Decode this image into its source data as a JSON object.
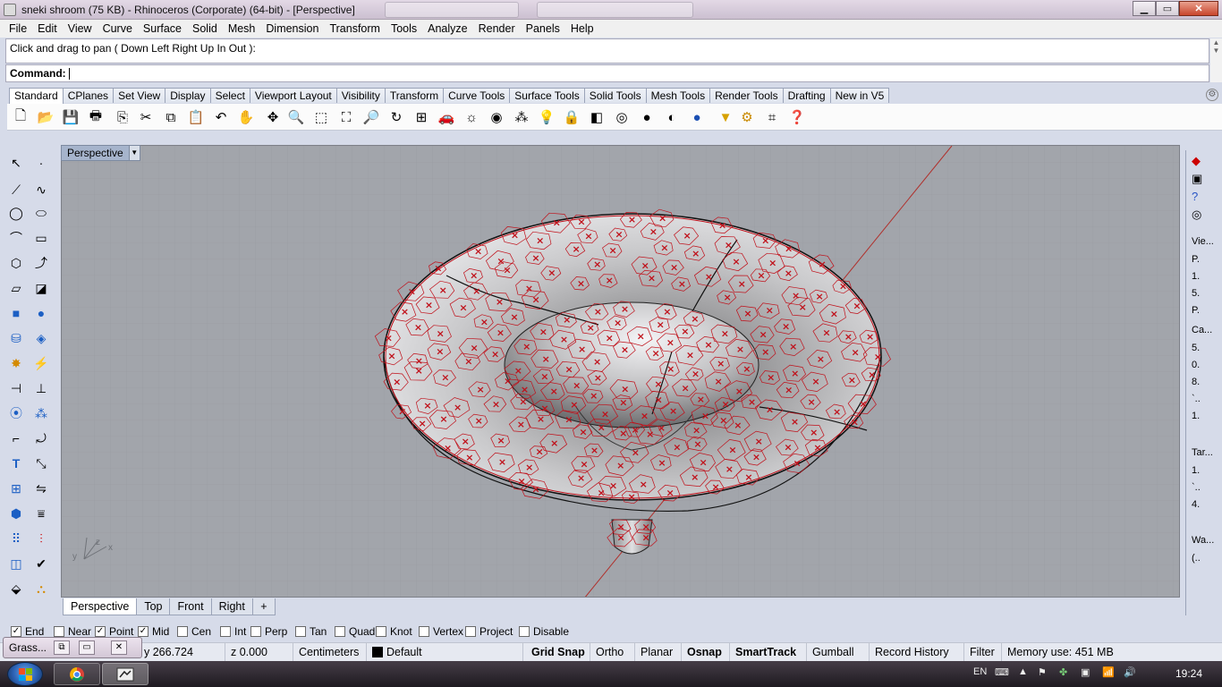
{
  "window": {
    "title": "sneki shroom (75 KB) - Rhinoceros (Corporate) (64-bit) - [Perspective]",
    "minimize_glyph": "▁",
    "maximize_glyph": "▭",
    "close_glyph": "✕"
  },
  "menu": [
    "File",
    "Edit",
    "View",
    "Curve",
    "Surface",
    "Solid",
    "Mesh",
    "Dimension",
    "Transform",
    "Tools",
    "Analyze",
    "Render",
    "Panels",
    "Help"
  ],
  "command": {
    "history": "Click and drag to pan ( Down  Left  Right  Up  In  Out ):",
    "prompt": "Command:",
    "value": ""
  },
  "toolbar_tabs": [
    "Standard",
    "CPlanes",
    "Set View",
    "Display",
    "Select",
    "Viewport Layout",
    "Visibility",
    "Transform",
    "Curve Tools",
    "Surface Tools",
    "Solid Tools",
    "Mesh Tools",
    "Render Tools",
    "Drafting",
    "New in V5"
  ],
  "toolbar_icons": [
    "new-icon",
    "open-icon",
    "save-icon",
    "print-icon",
    "import-icon",
    "cut-icon",
    "copy-icon",
    "paste-icon",
    "undo-icon",
    "pan-icon",
    "rotate-view-icon",
    "zoom-icon",
    "zoom-window-icon",
    "zoom-extents-icon",
    "zoom-selected-icon",
    "rotate-camera-icon",
    "four-viewports-icon",
    "car-icon",
    "light-icon",
    "point-display-icon",
    "grip-icon",
    "lightbulb-icon",
    "lock-icon",
    "layer-icon",
    "color-wheel-icon",
    "shaded-icon",
    "rendered-icon",
    "sphere-render-icon",
    "spotlight-icon",
    "settings-icon",
    "options-icon",
    "help-icon"
  ],
  "left_tool_icons": [
    "select-icon",
    "point-icon",
    "polyline-icon",
    "curve-icon",
    "circle-icon",
    "ellipse-icon",
    "arc-icon",
    "rectangle-icon",
    "polygon-icon",
    "freeform-curve-icon",
    "surface-icon",
    "sweep-icon",
    "box-icon",
    "sphere-icon",
    "cylinder-icon",
    "patch-icon",
    "explode-icon",
    "split-icon",
    "trim-icon",
    "extend-icon",
    "boolean-union-icon",
    "boolean-split-icon",
    "fillet-icon",
    "offset-icon",
    "text-icon",
    "scale-icon",
    "array-icon",
    "mirror-icon",
    "move-icon",
    "project-icon",
    "grid-icon",
    "align-icon",
    "dimension-icon",
    "check-icon",
    "render-icon",
    "paint-icon"
  ],
  "viewport": {
    "label": "Perspective",
    "axis_z": "z",
    "axis_y": "y",
    "axis_x": "x",
    "wireframe_color": "#c0101a",
    "background": "#a2a5ab"
  },
  "viewport_tabs": [
    "Perspective",
    "Top",
    "Front",
    "Right",
    "+"
  ],
  "right_panel": [
    "Vie...",
    "P.",
    "1.",
    "5.",
    "P.",
    "Ca...",
    "5.",
    "0.",
    "8.",
    "`..",
    "1.",
    "Tar...",
    "1.",
    "`..",
    "4.",
    "Wa...",
    "(.."
  ],
  "osnaps": [
    {
      "label": "End",
      "checked": true
    },
    {
      "label": "Near",
      "checked": false
    },
    {
      "label": "Point",
      "checked": true
    },
    {
      "label": "Mid",
      "checked": true
    },
    {
      "label": "Cen",
      "checked": false
    },
    {
      "label": "Int",
      "checked": false
    },
    {
      "label": "Perp",
      "checked": false
    },
    {
      "label": "Tan",
      "checked": false
    },
    {
      "label": "Quad",
      "checked": false
    },
    {
      "label": "Knot",
      "checked": false
    },
    {
      "label": "Vertex",
      "checked": false
    },
    {
      "label": "Project",
      "checked": false
    },
    {
      "label": "Disable",
      "checked": false
    }
  ],
  "statusbar": {
    "y": "y 266.724",
    "z": "z 0.000",
    "units": "Centimeters",
    "layer": "Default",
    "grid_snap": "Grid Snap",
    "ortho": "Ortho",
    "planar": "Planar",
    "osnap": "Osnap",
    "smarttrack": "SmartTrack",
    "gumball": "Gumball",
    "record_history": "Record History",
    "filter": "Filter",
    "memory": "Memory use: 451 MB"
  },
  "grasshopper_window": {
    "title": "Grass..."
  },
  "taskbar": {
    "language": "EN",
    "time": "19:24"
  }
}
